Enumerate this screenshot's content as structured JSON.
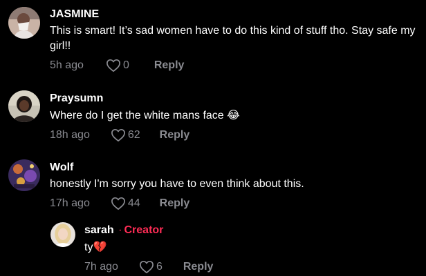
{
  "colors": {
    "background": "#000000",
    "text": "#ffffff",
    "muted": "#8a8b91",
    "creator_accent": "#fe2c55"
  },
  "comments": [
    {
      "username": "JASMINE",
      "avatar_icon": "avatar-photo",
      "text": "This is smart! It’s sad women have to do this kind of stuff tho. Stay safe my girl!!",
      "time": "5h ago",
      "likes": "0",
      "reply_label": "Reply"
    },
    {
      "username": "Praysumn",
      "avatar_icon": "avatar-photo",
      "text": "Where do I get the white mans face",
      "emoji": "😂",
      "time": "18h ago",
      "likes": "62",
      "reply_label": "Reply"
    },
    {
      "username": "Wolf",
      "avatar_icon": "avatar-photo",
      "text": "honestly I'm sorry you have to even think about this.",
      "time": "17h ago",
      "likes": "44",
      "reply_label": "Reply"
    }
  ],
  "reply": {
    "username": "sarah",
    "separator": "·",
    "badge": "Creator",
    "avatar_icon": "avatar-photo",
    "text": "ty",
    "emoji": "💔",
    "time": "7h ago",
    "likes": "6",
    "reply_label": "Reply"
  }
}
